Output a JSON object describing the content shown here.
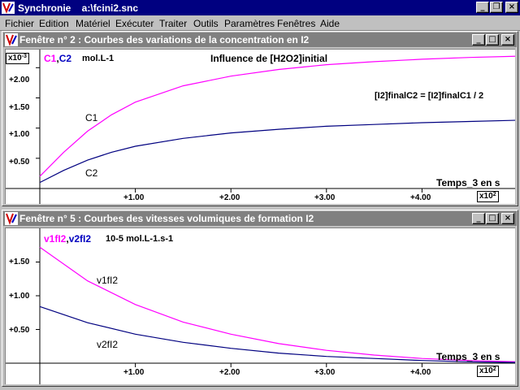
{
  "app": {
    "title": "Synchronie    a:\\fcini2.snc"
  },
  "menu": [
    "Fichier",
    "Edition",
    "Matériel",
    "Exécuter",
    "Traiter",
    "Outils",
    "Paramètres",
    "Fenêtres",
    "Aide"
  ],
  "window1": {
    "title": "Fenêtre n° 2 : Courbes des variations de la concentration en I2",
    "y_multiplier_base": "x10",
    "y_multiplier_exp": "-3",
    "series_c1": "C1",
    "series_sep": ",",
    "series_c2": "C2",
    "units": "mol.L-1",
    "heading": "Influence de [H2O2]initial",
    "relation": "[I2]finalC2 = [I2]finalC1 / 2",
    "curve_label_c1": "C1",
    "curve_label_c2": "C2",
    "x_label": "Temps_3 en s",
    "x_multiplier_base": "x10",
    "x_multiplier_exp": "2",
    "y_ticks": [
      "+2.00",
      "+1.50",
      "+1.00",
      "+0.50"
    ],
    "x_ticks": [
      "+1.00",
      "+2.00",
      "+3.00",
      "+4.00"
    ]
  },
  "window2": {
    "title": "Fenêtre n° 5 : Courbes des vitesses volumiques de formation I2",
    "series_v1": "v1fI2",
    "series_sep": ",",
    "series_v2": "v2fI2",
    "units": "10-5 mol.L-1.s-1",
    "curve_label_v1": "v1fI2",
    "curve_label_v2": "v2fI2",
    "x_label": "Temps_3 en s",
    "x_multiplier_base": "x10",
    "x_multiplier_exp": "2",
    "y_ticks": [
      "+1.50",
      "+1.00",
      "+0.50"
    ],
    "x_ticks": [
      "+1.00",
      "+2.00",
      "+3.00",
      "+4.00"
    ]
  },
  "chart_data": [
    {
      "type": "line",
      "x_unit_multiplier": 100,
      "y_unit_multiplier": 0.001,
      "xlim": [
        0,
        5
      ],
      "ylim": [
        0,
        2.3
      ],
      "x_ticks": [
        1,
        2,
        3,
        4
      ],
      "y_ticks": [
        0.5,
        1.0,
        1.5,
        2.0
      ],
      "grid": false,
      "series": [
        {
          "name": "C1",
          "color": "#ff00ff",
          "x": [
            0,
            0.25,
            0.5,
            0.75,
            1,
            1.5,
            2,
            2.5,
            3,
            3.5,
            4,
            4.5,
            5
          ],
          "y": [
            0.2,
            0.6,
            0.95,
            1.22,
            1.43,
            1.7,
            1.86,
            1.97,
            2.05,
            2.1,
            2.14,
            2.17,
            2.19
          ]
        },
        {
          "name": "C2",
          "color": "#000080",
          "x": [
            0,
            0.25,
            0.5,
            0.75,
            1,
            1.5,
            2,
            2.5,
            3,
            3.5,
            4,
            4.5,
            5
          ],
          "y": [
            0.1,
            0.3,
            0.47,
            0.6,
            0.7,
            0.83,
            0.92,
            0.98,
            1.03,
            1.06,
            1.09,
            1.11,
            1.13
          ]
        }
      ]
    },
    {
      "type": "line",
      "x_unit_multiplier": 100,
      "xlim": [
        0,
        5
      ],
      "ylim": [
        0,
        2.0
      ],
      "x_ticks": [
        1,
        2,
        3,
        4
      ],
      "y_ticks": [
        0.5,
        1.0,
        1.5
      ],
      "grid": false,
      "series": [
        {
          "name": "v1fI2",
          "color": "#ff00ff",
          "x": [
            0,
            0.5,
            1,
            1.5,
            2,
            2.5,
            3,
            3.5,
            4,
            4.5,
            5
          ],
          "y": [
            1.72,
            1.22,
            0.87,
            0.61,
            0.43,
            0.29,
            0.19,
            0.12,
            0.07,
            0.04,
            0.02
          ]
        },
        {
          "name": "v2fI2",
          "color": "#000080",
          "x": [
            0,
            0.5,
            1,
            1.5,
            2,
            2.5,
            3,
            3.5,
            4,
            4.5,
            5
          ],
          "y": [
            0.84,
            0.6,
            0.43,
            0.31,
            0.22,
            0.15,
            0.1,
            0.07,
            0.04,
            0.02,
            0.01
          ]
        }
      ]
    }
  ]
}
